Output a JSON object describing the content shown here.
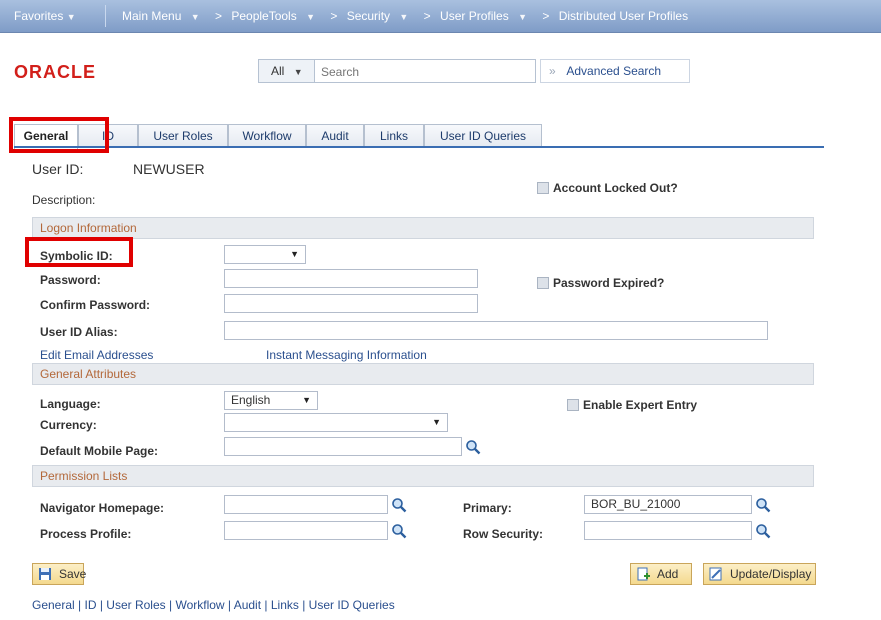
{
  "nav": {
    "favorites": "Favorites",
    "breadcrumbs": [
      "Main Menu",
      "PeopleTools",
      "Security",
      "User Profiles",
      "Distributed User Profiles"
    ]
  },
  "logo": "ORACLE",
  "search": {
    "scope": "All",
    "placeholder": "Search",
    "advanced_label": "Advanced Search"
  },
  "tabs": [
    "General",
    "ID",
    "User Roles",
    "Workflow",
    "Audit",
    "Links",
    "User ID Queries"
  ],
  "active_tab": "General",
  "user": {
    "id_label": "User ID:",
    "id_value": "NEWUSER",
    "description_label": "Description:",
    "account_locked_label": "Account Locked Out?"
  },
  "logon": {
    "section_title": "Logon Information",
    "symbolic_id_label": "Symbolic ID:",
    "password_label": "Password:",
    "confirm_password_label": "Confirm Password:",
    "user_id_alias_label": "User ID Alias:",
    "password_expired_label": "Password Expired?",
    "edit_email_link": "Edit Email Addresses",
    "instant_messaging_link": "Instant Messaging Information"
  },
  "general_attributes": {
    "section_title": "General Attributes",
    "language_label": "Language:",
    "language_value": "English",
    "currency_label": "Currency:",
    "default_mobile_label": "Default Mobile Page:",
    "expert_entry_label": "Enable Expert Entry"
  },
  "permission_lists": {
    "section_title": "Permission Lists",
    "navigator_label": "Navigator Homepage:",
    "process_profile_label": "Process Profile:",
    "primary_label": "Primary:",
    "primary_value": "BOR_BU_21000",
    "row_security_label": "Row Security:"
  },
  "buttons": {
    "save": "Save",
    "add": "Add",
    "update_display": "Update/Display"
  },
  "footer_links": [
    "General",
    "ID",
    "User Roles",
    "Workflow",
    "Audit",
    "Links",
    "User ID Queries"
  ],
  "colors": {
    "accent_red": "#e00000",
    "link_blue": "#2a4f8e",
    "section_text": "#b3683a",
    "oracle_red": "#d21f1a"
  }
}
